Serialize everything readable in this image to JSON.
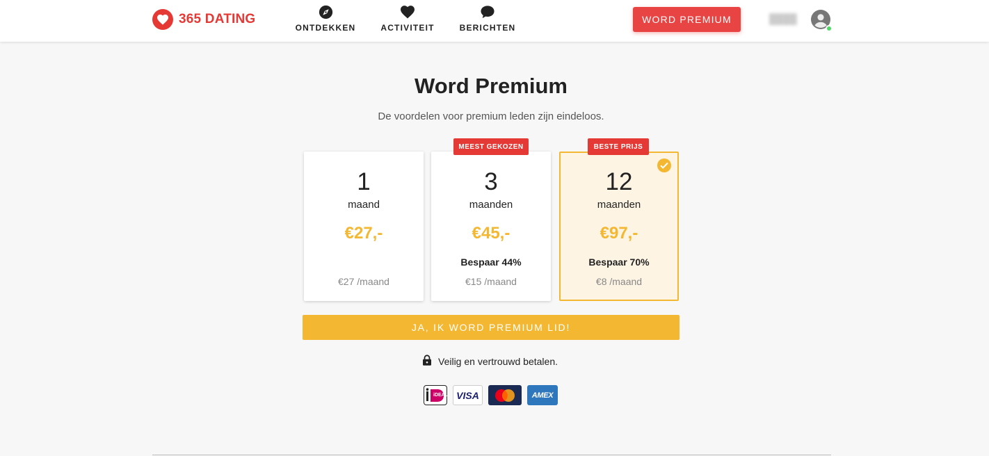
{
  "brand": {
    "name": "365 DATING",
    "color": "#e53935"
  },
  "nav": [
    {
      "label": "ONTDEKKEN",
      "icon": "compass-icon"
    },
    {
      "label": "ACTIVITEIT",
      "icon": "heart-icon"
    },
    {
      "label": "BERICHTEN",
      "icon": "chat-bubble-icon"
    }
  ],
  "header": {
    "premium_button": "WORD PREMIUM"
  },
  "user": {
    "online": true,
    "avatar_icon": "account-circle-icon"
  },
  "page": {
    "title": "Word Premium",
    "subtitle": "De voordelen voor premium leden zijn eindeloos."
  },
  "plans": [
    {
      "amount": "1",
      "unit": "maand",
      "price": "€27,-",
      "savings": "",
      "per_month": "€27 /maand",
      "badge": "",
      "selected": false
    },
    {
      "amount": "3",
      "unit": "maanden",
      "price": "€45,-",
      "savings": "Bespaar 44%",
      "per_month": "€15 /maand",
      "badge": "MEEST GEKOZEN",
      "selected": false
    },
    {
      "amount": "12",
      "unit": "maanden",
      "price": "€97,-",
      "savings": "Bespaar 70%",
      "per_month": "€8 /maand",
      "badge": "BESTE PRIJS",
      "selected": true
    }
  ],
  "cta": {
    "label": "JA, IK WORD PREMIUM LID!"
  },
  "secure": {
    "text": "Veilig en vertrouwd betalen.",
    "icon": "lock-icon"
  },
  "payments": {
    "ideal": "iDEAL",
    "visa": "VISA",
    "mastercard": "mastercard-logo",
    "amex": "AMEX"
  },
  "colors": {
    "accent_red": "#e53935",
    "premium_yellow": "#f4b731",
    "selected_bg": "#fdf4e3",
    "page_bg": "#f7f7f7",
    "online_green": "#4cd964"
  }
}
